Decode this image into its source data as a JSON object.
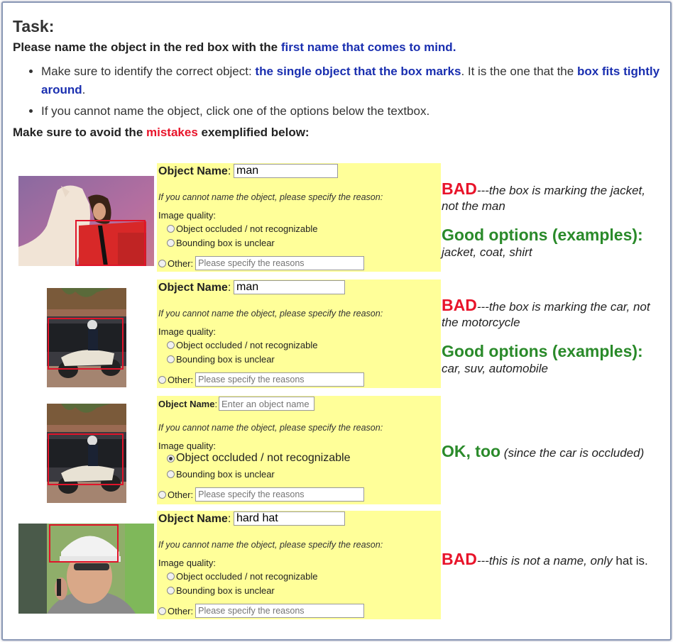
{
  "header": {
    "title": "Task:",
    "instruction_pre": "Please name the object in the red box with the ",
    "instruction_highlight": "first name that comes to mind.",
    "rule1_pre": "Make sure to identify the correct object: ",
    "rule1_bold1": "the single object that the box marks",
    "rule1_mid": ". It is the one that the ",
    "rule1_bold2": "box fits tightly around",
    "rule1_end": ".",
    "rule2": "If you cannot name the object, click one of the options below the textbox.",
    "avoid_pre": "Make sure to avoid the ",
    "avoid_highlight": "mistakes",
    "avoid_post": " exemplified below:"
  },
  "form_common": {
    "name_label": "Object Name",
    "colon": ":",
    "hint": "If you cannot name the object, please specify the reason:",
    "image_quality": "Image quality:",
    "opt_occluded": "Object occluded / not recognizable",
    "opt_bbox": "Bounding box is unclear",
    "other_label": "Other:",
    "other_placeholder": "Please specify the reasons",
    "name_placeholder": "Enter an object name"
  },
  "examples": [
    {
      "image": "horse-and-woman-photo",
      "name_value": "man",
      "verdict_tag": "BAD",
      "verdict_text": "---the box is marking the jacket, not the man",
      "good_heading": "Good options (examples):",
      "good_list": "jacket, coat, shirt"
    },
    {
      "image": "police-motorcycle-photo",
      "name_value": "man",
      "verdict_tag": "BAD",
      "verdict_text": "---the box is marking the car, not the motorcycle",
      "good_heading": "Good options (examples):",
      "good_list": "car, suv, automobile"
    },
    {
      "image": "police-motorcycle-photo",
      "name_value": "",
      "selected_option": "occluded",
      "verdict_tag": "OK, too",
      "verdict_text": "(since the car is occluded)"
    },
    {
      "image": "man-with-helmet-photo",
      "name_value": "hard hat",
      "verdict_tag": "BAD",
      "verdict_text_italic": "---this is not a name, only",
      "verdict_text_tail": " hat is."
    }
  ],
  "colors": {
    "red": "#e8142a",
    "blue": "#1a2fb0",
    "green": "#2a8a2a",
    "form_bg": "#ffff99"
  }
}
